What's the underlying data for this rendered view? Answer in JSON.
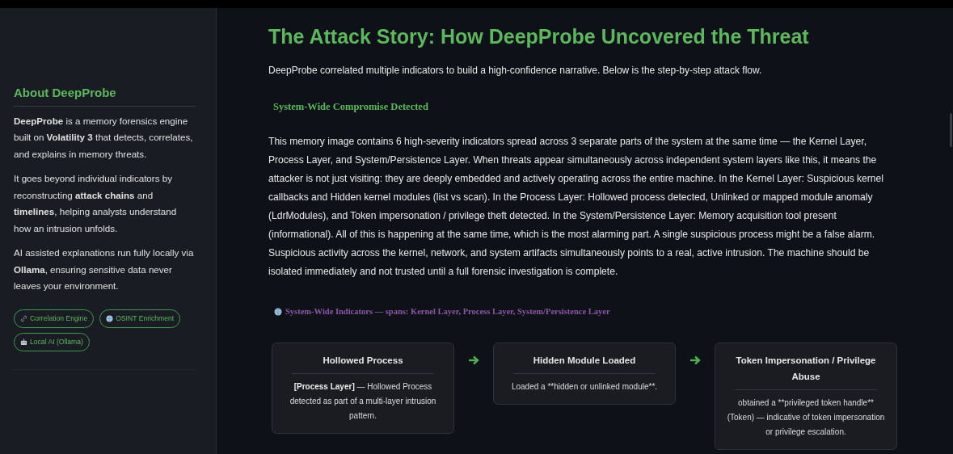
{
  "sidebar": {
    "heading": "About DeepProbe",
    "paragraphs": [
      "**DeepProbe** is a memory forensics engine built on **Volatility 3** that detects, correlates, and explains in memory threats.",
      "It goes beyond individual indicators by reconstructing **attack chains** and **timelines**, helping analysts understand how an intrusion unfolds.",
      "AI assisted explanations run fully locally via **Ollama**, ensuring sensitive data never leaves your environment."
    ],
    "chips": [
      {
        "kind": "link",
        "label": "Correlation Engine"
      },
      {
        "kind": "globe",
        "label": "OSINT Enrichment"
      },
      {
        "kind": "robot",
        "label": "Local AI (Ollama)"
      }
    ]
  },
  "main": {
    "title": "The Attack Story: How DeepProbe Uncovered the Threat",
    "intro": "DeepProbe correlated multiple indicators to build a high-confidence narrative. Below is the step-by-step attack flow.",
    "alert_heading": "System-Wide Compromise Detected",
    "summary": "This memory image contains 6 high-severity indicators spread across 3 separate parts of the system at the same time — the Kernel Layer, Process Layer, and System/Persistence Layer. When threats appear simultaneously across independent system layers like this, it means the attacker is not just visiting: they are deeply embedded and actively operating across the entire machine. In the Kernel Layer: Suspicious kernel callbacks and Hidden kernel modules (list vs scan). In the Process Layer: Hollowed process detected, Unlinked or mapped module anomaly (LdrModules), and Token impersonation / privilege theft detected. In the System/Persistence Layer: Memory acquisition tool present (informational). All of this is happening at the same time, which is the most alarming part. A single suspicious process might be a false alarm. Suspicious activity across the kernel, network, and system artifacts simultaneously points to a real, active intrusion. The machine should be isolated immediately and not trusted until a full forensic investigation is complete.",
    "indicators_line": "System-Wide Indicators — spans: Kernel Layer, Process Layer, System/Persistence Layer",
    "steps": [
      {
        "title": "Hollowed Process",
        "tag": "[Process Layer]",
        "text": " — Hollowed Process detected as part of a multi-layer intrusion pattern."
      },
      {
        "title": "Hidden Module Loaded",
        "text": "Loaded a **hidden or unlinked module**."
      },
      {
        "title": "Token Impersonation / Privilege Abuse",
        "text": "obtained a **privileged token handle** (Token) — indicative of token impersonation or privilege escalation."
      }
    ]
  }
}
